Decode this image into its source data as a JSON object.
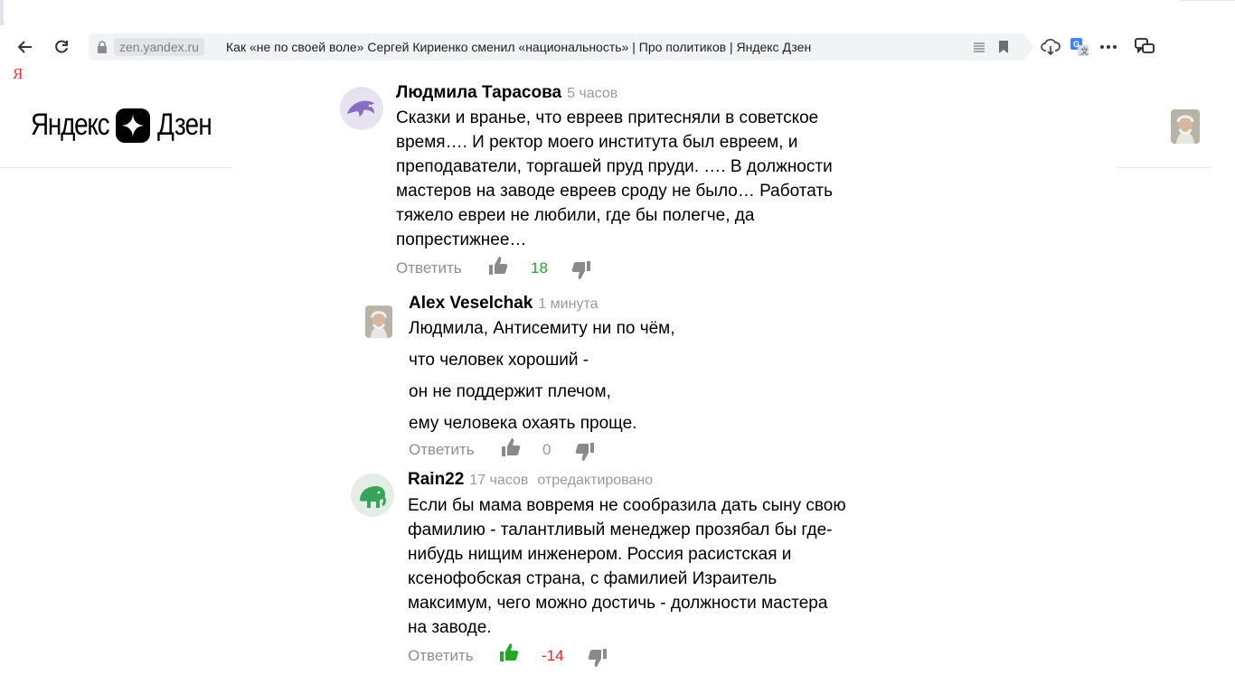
{
  "browser": {
    "domain": "zen.yandex.ru",
    "tab_title": "Как «не по своей воле» Сергей Кириенко сменил «национальность» | Про политиков | Яндекс Дзен",
    "partial_letter": "Я"
  },
  "header": {
    "logo_left": "Яндекс",
    "logo_right": "Дзен"
  },
  "comments": [
    {
      "author": "Людмила Тарасова",
      "time": "5 часов",
      "lines": [
        "Сказки и вранье, что евреев притесняли в советское",
        "время…. И ректор моего института был евреем, и",
        "преподаватели, торгашей пруд пруди. …. В должности",
        "мастеров на заводе евреев сроду не было… Работать",
        "тяжело евреи не любили, где бы полегче, да",
        "попрестижнее…"
      ],
      "reply_label": "Ответить",
      "score": "18",
      "score_color": "#2e9e2e"
    },
    {
      "author": "Alex Veselchak",
      "time": "1 минута",
      "lines": [
        "Людмила, Антисемиту ни по чём,",
        "что человек хороший -",
        "он не поддержит плечом,",
        "ему человека охаять проще."
      ],
      "reply_label": "Ответить",
      "score": "0",
      "score_color": "#9a9a9a"
    },
    {
      "author": "Rain22",
      "time": "17 часов",
      "edited": "отредактировано",
      "lines": [
        "Если бы мама вовремя не сообразила дать сыну свою",
        "фамилию - талантливый менеджер прозябал бы где-",
        "нибудь нищим инженером. Россия расистская и",
        "ксенофобская страна, с фамилией Израитель",
        "максимум, чего можно достичь - должности мастера",
        "на заводе."
      ],
      "reply_label": "Ответить",
      "score": "-14",
      "score_color": "#e02424",
      "liked": true
    }
  ],
  "colors": {
    "like_active": "#22a822",
    "icon_gray": "#8a8a8a"
  }
}
